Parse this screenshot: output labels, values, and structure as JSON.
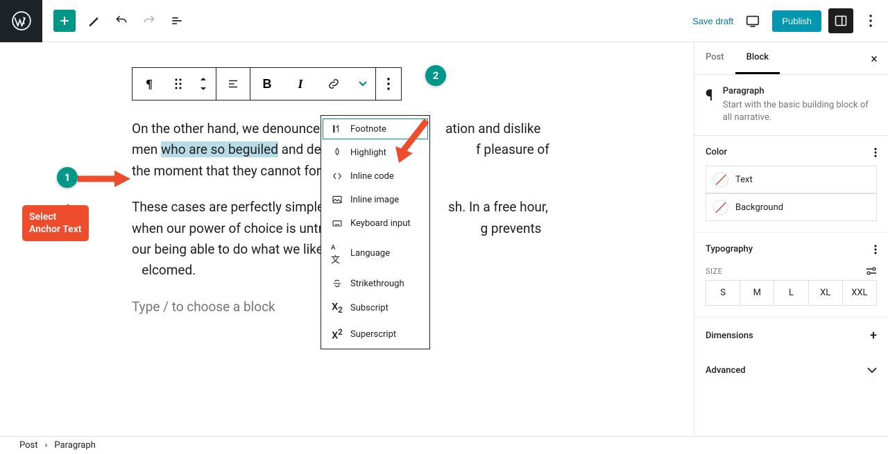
{
  "header": {
    "save_draft": "Save draft",
    "publish": "Publish"
  },
  "content": {
    "p1_before_sel": "On the other hand, we denounce w",
    "p1_gap1": "ation and dislike men ",
    "p1_sel": "who are so beguiled",
    "p1_after_sel": " and demoralis",
    "p1_gap2": "f pleasure of the moment that they cannot foresee t",
    "p2_a": "These cases are perfectly simple a",
    "p2_b": "sh. In a free hour, when our power of choice is untrammelle",
    "p2_c": "g prevents our being able to do what we like best, every",
    "p2_d": "elcomed.",
    "placeholder": "Type / to choose a block"
  },
  "dropdown": {
    "items": [
      {
        "label": "Footnote",
        "icon": "footnote"
      },
      {
        "label": "Highlight",
        "icon": "highlight"
      },
      {
        "label": "Inline code",
        "icon": "code"
      },
      {
        "label": "Inline image",
        "icon": "image"
      },
      {
        "label": "Keyboard input",
        "icon": "keyboard"
      },
      {
        "label": "Language",
        "icon": "language"
      },
      {
        "label": "Strikethrough",
        "icon": "strike"
      },
      {
        "label": "Subscript",
        "icon": "sub"
      },
      {
        "label": "Superscript",
        "icon": "sup"
      }
    ]
  },
  "sidebar": {
    "tabs": {
      "post": "Post",
      "block": "Block"
    },
    "block_name": "Paragraph",
    "block_desc": "Start with the basic building block of all narrative.",
    "color": {
      "title": "Color",
      "text": "Text",
      "background": "Background"
    },
    "typography": {
      "title": "Typography",
      "size_label": "SIZE",
      "sizes": [
        "S",
        "M",
        "L",
        "XL",
        "XXL"
      ]
    },
    "dimensions": "Dimensions",
    "advanced": "Advanced"
  },
  "footer": {
    "post": "Post",
    "paragraph": "Paragraph"
  },
  "annotations": {
    "callout": "Select\nAnchor Text",
    "badge1": "1",
    "badge2": "2"
  }
}
